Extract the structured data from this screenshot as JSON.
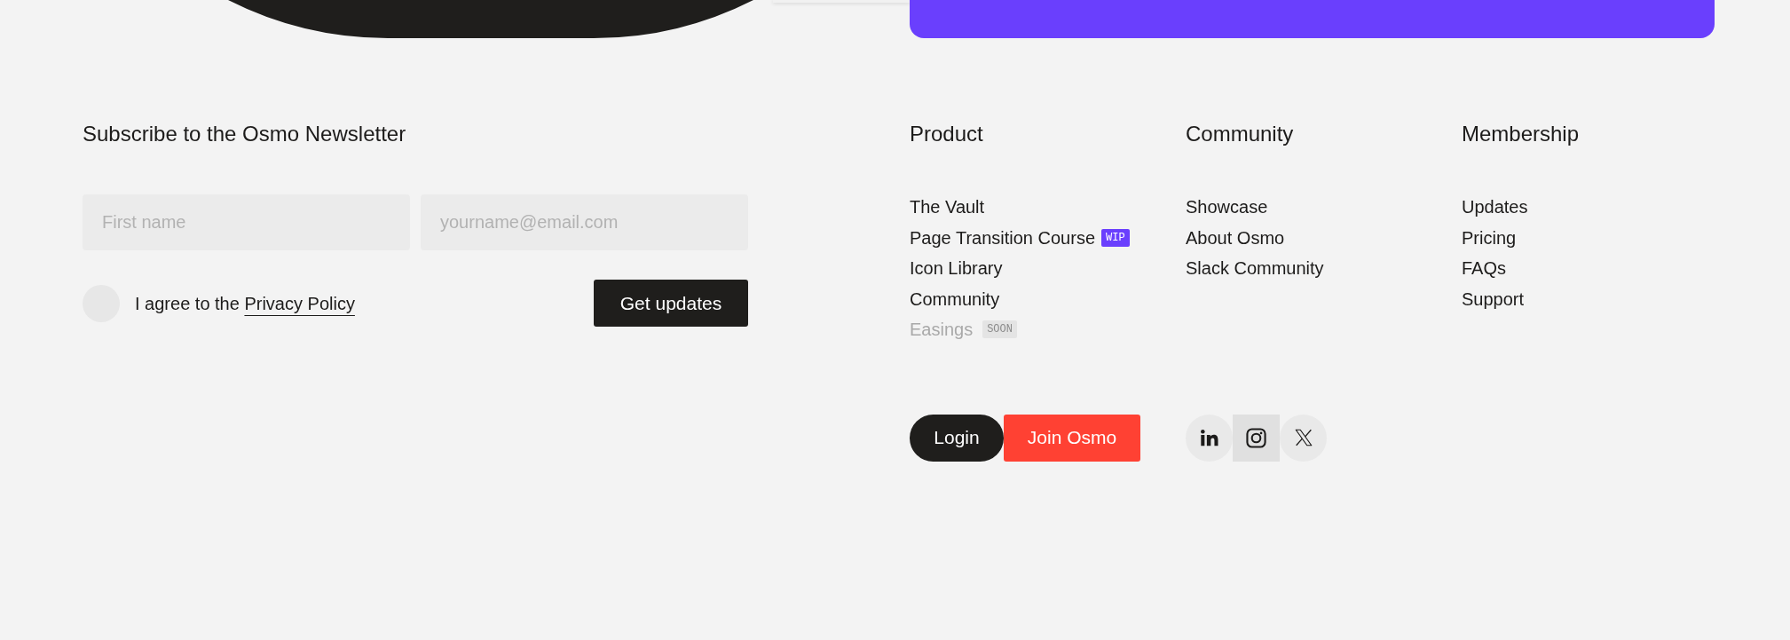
{
  "newsletter": {
    "title": "Subscribe to the Osmo Newsletter",
    "fields": [
      {
        "placeholder": "First name"
      },
      {
        "placeholder": "yourname@email.com"
      }
    ],
    "consent": {
      "checked": false,
      "text": "I agree to the",
      "link": "Privacy Policy"
    },
    "submit": "Get updates"
  },
  "columns": [
    {
      "title": "Product",
      "links": [
        {
          "label": "The Vault",
          "disabled": false
        },
        {
          "label": "Page Transition Course",
          "disabled": false,
          "badge": {
            "label": "WIP",
            "kind": "progress"
          }
        },
        {
          "label": "Icon Library",
          "disabled": false
        },
        {
          "label": "Community",
          "disabled": false
        },
        {
          "label": "Easings",
          "disabled": true,
          "badge": {
            "label": "SOON",
            "kind": "upcoming"
          }
        }
      ]
    },
    {
      "title": "Community",
      "links": [
        {
          "label": "Showcase",
          "disabled": false
        },
        {
          "label": "About Osmo",
          "disabled": false
        },
        {
          "label": "Slack Community",
          "disabled": false
        }
      ]
    },
    {
      "title": "Membership",
      "links": [
        {
          "label": "Updates",
          "disabled": false
        },
        {
          "label": "Pricing",
          "disabled": false
        },
        {
          "label": "FAQs",
          "disabled": false
        },
        {
          "label": "Support",
          "disabled": false
        }
      ]
    }
  ],
  "actions": [
    {
      "label": "Login",
      "kind": "secondary"
    },
    {
      "label": "Join Osmo",
      "kind": "primary"
    }
  ],
  "socials": [
    {
      "kind": "linkedin",
      "hovered": false
    },
    {
      "kind": "instagram",
      "hovered": true
    },
    {
      "kind": "x",
      "hovered": false
    }
  ]
}
